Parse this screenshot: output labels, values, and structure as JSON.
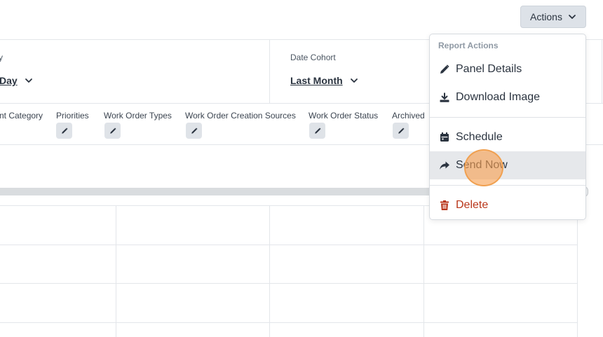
{
  "toolbar": {
    "actions_label": "Actions"
  },
  "filters": {
    "left_label_fragment": "y",
    "left_value": "Day",
    "cohort_label": "Date Cohort",
    "cohort_value": "Last Month"
  },
  "columns": [
    {
      "label": "nt Category",
      "editable": false
    },
    {
      "label": "Priorities",
      "editable": true
    },
    {
      "label": "Work Order Types",
      "editable": true
    },
    {
      "label": "Work Order Creation Sources",
      "editable": true
    },
    {
      "label": "Work Order Status",
      "editable": true
    },
    {
      "label": "Archived",
      "editable": true
    }
  ],
  "menu": {
    "header": "Report Actions",
    "items": {
      "panel_details": "Panel Details",
      "download_image": "Download Image",
      "schedule": "Schedule",
      "send_now": "Send Now",
      "delete": "Delete"
    }
  },
  "colors": {
    "danger": "#b9361a",
    "click_indicator": "#f0a050",
    "chip": "#dfe3e8"
  },
  "icons": [
    "chevron-down-icon",
    "pencil-icon",
    "download-icon",
    "calendar-icon",
    "share-icon",
    "trash-icon"
  ]
}
